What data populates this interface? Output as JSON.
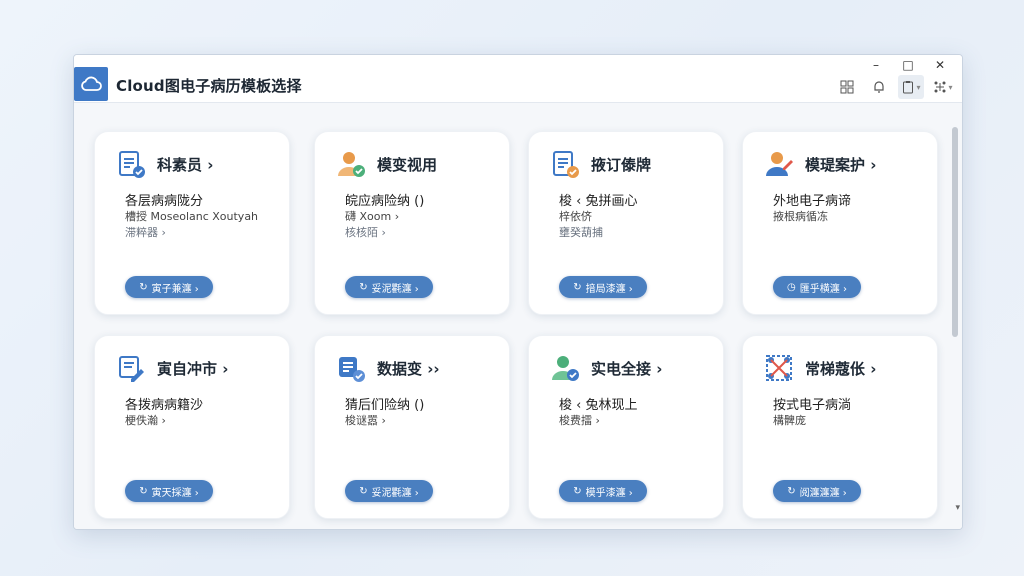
{
  "window": {
    "title": "Cloud图电子病历模板选择",
    "controls": {
      "minimize": "–",
      "maximize": "□",
      "close": "✕"
    },
    "tools": [
      "grid-icon",
      "bell-icon",
      "clipboard-icon",
      "settings-grid-icon"
    ]
  },
  "colors": {
    "accent": "#4a7fc0",
    "icon_blue": "#3f79c6",
    "icon_orange": "#e89a4a",
    "icon_green": "#4caf7a"
  },
  "cards": [
    {
      "icon": "clipboard-check-icon",
      "title": "科素员 ›",
      "line1": "各层病病陇分",
      "line2": "槽授 Moseolanc Xoutyah",
      "line3": "滞粹器 ›",
      "button": "寅子兼瀍 ›"
    },
    {
      "icon": "doctor-check-icon",
      "title": "模变视用",
      "line1": "皖应病险纳 ()",
      "line2": "礴 Xoom ›",
      "line3": "核核陌 ›",
      "button": "妥泥氍瀍 ›"
    },
    {
      "icon": "document-check-icon",
      "title": "掖订傣牌",
      "line1": "梭 ‹ 兔拼画心",
      "line2": "梓依侪",
      "line3": "壅癸葫捕",
      "button": "揞局漆瀍 ›"
    },
    {
      "icon": "doctor-edit-icon",
      "title": "模瑅案护 ›",
      "line1": "外地电子病谛",
      "line2": "掖根病循冻",
      "line3": "",
      "button": "匯乎横瀍 ›"
    },
    {
      "icon": "edit-document-icon",
      "title": "寅自冲市 ›",
      "line1": "各拨病病籍沙",
      "line2": "梗佚瀚 ›",
      "line3": "",
      "button": "寅天採瀍 ›"
    },
    {
      "icon": "data-check-icon",
      "title": "数据变 ››",
      "line1": "猜后们险纳 ()",
      "line2": "梭谜嚣 ›",
      "line3": "",
      "button": "妥泥氍瀍 ›"
    },
    {
      "icon": "user-check-icon",
      "title": "实电全接 ›",
      "line1": "梭 ‹ 兔林现上",
      "line2": "梭费擂 ›",
      "line3": "",
      "button": "模乎漆瀍 ›"
    },
    {
      "icon": "network-icon",
      "title": "常梯蔻伥 ›",
      "line1": "按式电子病淌",
      "line2": "構髀庞",
      "line3": "",
      "button": "阅瀍瀍瀍 ›"
    }
  ]
}
